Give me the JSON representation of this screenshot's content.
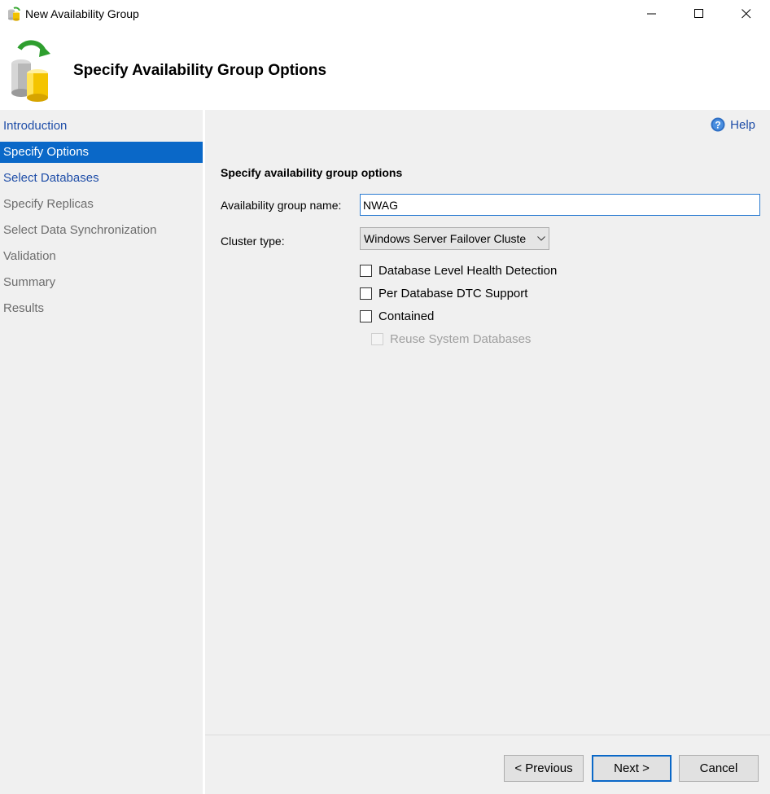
{
  "window": {
    "title": "New Availability Group",
    "icon": "availability-group-icon",
    "controls": [
      "minimize-icon",
      "maximize-icon",
      "close-icon"
    ]
  },
  "header": {
    "title": "Specify Availability Group Options",
    "icon": "database-sync-icon"
  },
  "sidebar": {
    "items": [
      {
        "label": "Introduction",
        "state": "link"
      },
      {
        "label": "Specify Options",
        "state": "active"
      },
      {
        "label": "Select Databases",
        "state": "link"
      },
      {
        "label": "Specify Replicas",
        "state": "disabled"
      },
      {
        "label": "Select Data Synchronization",
        "state": "disabled"
      },
      {
        "label": "Validation",
        "state": "disabled"
      },
      {
        "label": "Summary",
        "state": "disabled"
      },
      {
        "label": "Results",
        "state": "disabled"
      }
    ]
  },
  "main": {
    "help_label": "Help",
    "section_heading": "Specify availability group options",
    "ag_name_label": "Availability group name:",
    "ag_name_value": "NWAG",
    "cluster_type_label": "Cluster type:",
    "cluster_type_value": "Windows Server Failover Cluste",
    "options": [
      {
        "label": "Database Level Health Detection",
        "checked": false,
        "enabled": true
      },
      {
        "label": "Per Database DTC Support",
        "checked": false,
        "enabled": true
      },
      {
        "label": "Contained",
        "checked": false,
        "enabled": true
      },
      {
        "label": "Reuse System Databases",
        "checked": false,
        "enabled": false
      }
    ]
  },
  "footer": {
    "previous_label": "< Previous",
    "next_label": "Next >",
    "cancel_label": "Cancel"
  },
  "colors": {
    "accent": "#0a68c8",
    "link": "#1f4ea8",
    "panel": "#f0f0f0"
  }
}
